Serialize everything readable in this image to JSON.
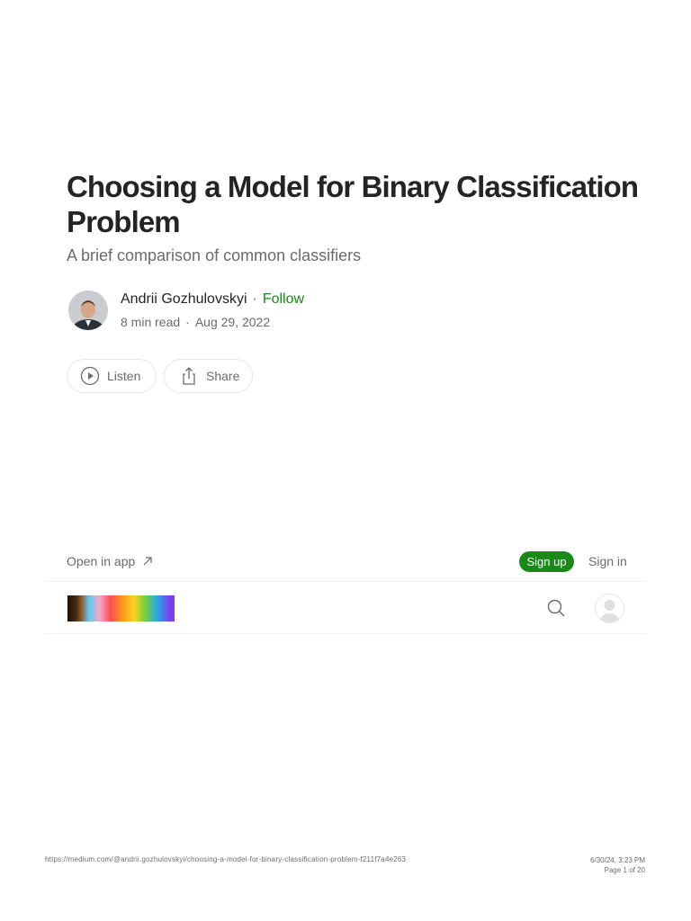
{
  "article": {
    "title": "Choosing a Model for Binary Classification Problem",
    "subtitle": "A brief comparison of common classifiers",
    "author": "Andrii Gozhulovskyi",
    "separator": "·",
    "follow_label": "Follow",
    "read_time": "8 min read",
    "date": "Aug 29, 2022"
  },
  "actions": {
    "listen_label": "Listen",
    "share_label": "Share"
  },
  "topbar": {
    "open_in_app_label": "Open in app",
    "sign_up_label": "Sign up",
    "sign_in_label": "Sign in"
  },
  "icons": {
    "listen": "play-circle-icon",
    "share": "share-icon",
    "open_in_app": "arrow-up-right-icon",
    "search": "search-icon",
    "user": "user-avatar-icon"
  },
  "colors": {
    "accent": "#1a8917",
    "text": "#242424",
    "muted": "#6b6b6b"
  },
  "footer": {
    "url": "https://medium.com/@andrii.gozhulovskyi/choosing-a-model-for-binary-classification-problem-f211f7a4e263",
    "timestamp": "6/30/24, 3:23 PM",
    "page": "Page 1 of 20"
  }
}
